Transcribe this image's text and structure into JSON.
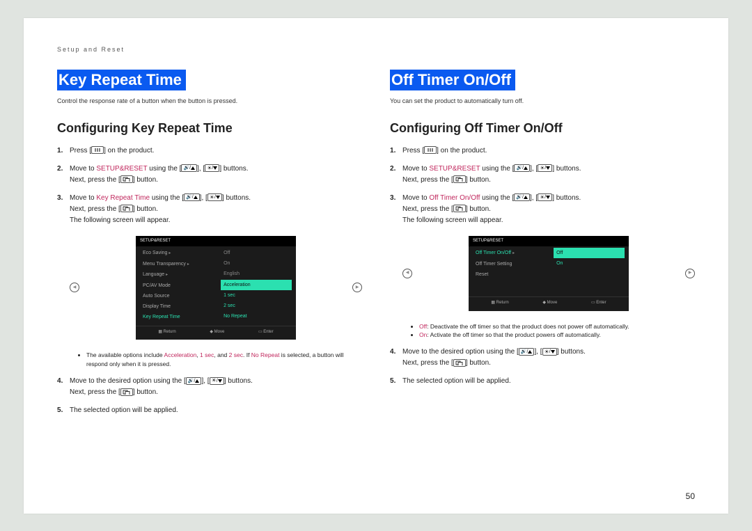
{
  "breadcrumb": "Setup and Reset",
  "pageNumber": "50",
  "navhints": {
    "return": "Return",
    "move": "Move",
    "enter": "Enter"
  },
  "left": {
    "title": "Key Repeat Time",
    "lede": "Control the response rate of a button when the button is pressed.",
    "subtitle": "Configuring Key Repeat Time",
    "steps": {
      "s1a": "Press [",
      "s1b": "] on the product.",
      "s2a": "Move to ",
      "s2hl": "SETUP&RESET",
      "s2b": " using the [",
      "s2c": "], [",
      "s2d": "] buttons.",
      "s2e": "Next, press the [",
      "s2f": "] button.",
      "s3a": "Move to ",
      "s3hl": "Key Repeat Time",
      "s3b": " using the [",
      "s3c": "], [",
      "s3d": "] buttons.",
      "s3e": "Next, press the [",
      "s3f": "] button.",
      "s3g": "The following screen will appear.",
      "note_a": "The available options include ",
      "note_accel": "Acceleration",
      "note_sep1": ", ",
      "note_1sec": "1 sec",
      "note_sep2": ", and ",
      "note_2sec": "2 sec",
      "note_sep3": ". If ",
      "note_norep": "No Repeat",
      "note_b": " is selected, a button will respond only when it is pressed.",
      "s4a": "Move to the desired option using the [",
      "s4b": "], [",
      "s4c": "] buttons.",
      "s4d": "Next, press the [",
      "s4e": "] button.",
      "s5": "The selected option will be applied."
    },
    "osd": {
      "title": "SETUP&RESET",
      "leftItems": [
        "Eco Saving",
        "Menu Transparency",
        "Language",
        "PC/AV Mode",
        "Auto Source",
        "Display Time",
        "Key Repeat Time"
      ],
      "rightItems": [
        "Off",
        "On",
        "English",
        "",
        "",
        "",
        ""
      ],
      "selIndex": 6,
      "rightOptions": [
        "Acceleration",
        "1 sec",
        "2 sec",
        "No Repeat"
      ],
      "rightSel": 0
    }
  },
  "right": {
    "title": "Off Timer On/Off",
    "lede": "You can set the product to automatically turn off.",
    "subtitle": "Configuring Off Timer On/Off",
    "steps": {
      "s1a": "Press [",
      "s1b": "] on the product.",
      "s2a": "Move to ",
      "s2hl": "SETUP&RESET",
      "s2b": " using the [",
      "s2c": "], [",
      "s2d": "] buttons.",
      "s2e": "Next, press the [",
      "s2f": "] button.",
      "s3a": "Move to ",
      "s3hl": "Off Timer On/Off",
      "s3b": " using the [",
      "s3c": "], [",
      "s3d": "] buttons.",
      "s3e": "Next, press the [",
      "s3f": "] button.",
      "s3g": "The following screen will appear.",
      "off_lbl": "Off",
      "off_txt": ": Deactivate the off timer so that the product does not power off automatically.",
      "on_lbl": "On",
      "on_txt": ": Activate the off timer so that the product powers off automatically.",
      "s4a": "Move to the desired option using the [",
      "s4b": "], [",
      "s4c": "] buttons.",
      "s4d": "Next, press the [",
      "s4e": "] button.",
      "s5": "The selected option will be applied."
    },
    "osd": {
      "title": "SETUP&RESET",
      "leftItems": [
        "Off Timer On/Off",
        "Off Timer Setting",
        "Reset"
      ],
      "selIndex": 0,
      "rightOptions": [
        "Off",
        "On"
      ],
      "rightSel": 0
    }
  }
}
